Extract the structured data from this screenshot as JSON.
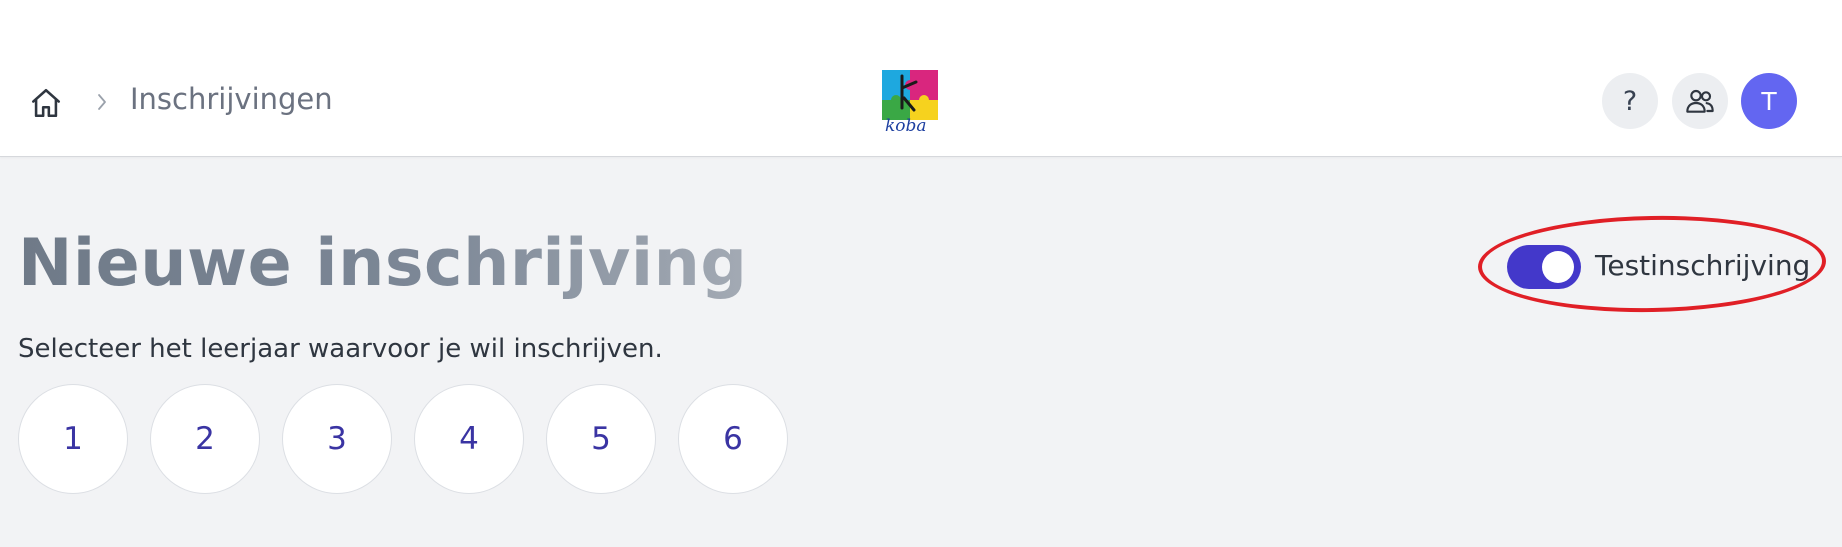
{
  "header": {
    "breadcrumb": {
      "home_icon": "home-icon",
      "separator_icon": "chevron-right-icon",
      "current_label": "Inschrijvingen"
    },
    "logo_text": "koba",
    "help_label": "?",
    "users_icon": "users-icon",
    "avatar_initial": "T"
  },
  "main": {
    "title": "Nieuwe inschrijving",
    "instruction": "Selecteer het leerjaar waarvoor je wil inschrijven.",
    "grades": [
      "1",
      "2",
      "3",
      "4",
      "5",
      "6"
    ],
    "test_toggle": {
      "label": "Testinschrijving",
      "checked": true,
      "accent_color": "#4338ca"
    }
  },
  "annotation": {
    "highlight_color": "#e01f26"
  }
}
